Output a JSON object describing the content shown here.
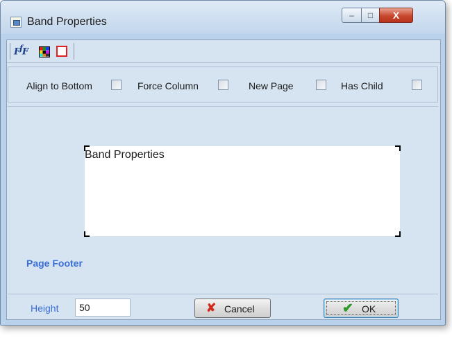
{
  "window": {
    "title": "Band Properties",
    "controls": {
      "minimize": "–",
      "maximize": "□",
      "close": "X"
    }
  },
  "toolbar": {
    "font_icon": "font-icon",
    "color_icon": "color-palette-icon",
    "border_icon": "border-icon"
  },
  "options": [
    {
      "label": "Align to Bottom",
      "checked": false
    },
    {
      "label": "Force Column",
      "checked": false
    },
    {
      "label": "New Page",
      "checked": false
    },
    {
      "label": "Has Child",
      "checked": false
    }
  ],
  "preview": {
    "text": "Band Properties"
  },
  "band": {
    "name": "Page Footer"
  },
  "height": {
    "label": "Height",
    "value": "50"
  },
  "buttons": {
    "cancel": {
      "label": "Cancel",
      "icon": "x-icon"
    },
    "ok": {
      "label": "OK",
      "icon": "checkmark-icon"
    }
  },
  "colors": {
    "accent_blue": "#3b6fd6",
    "cancel_red": "#d22a1b",
    "ok_green": "#2b9a28"
  }
}
